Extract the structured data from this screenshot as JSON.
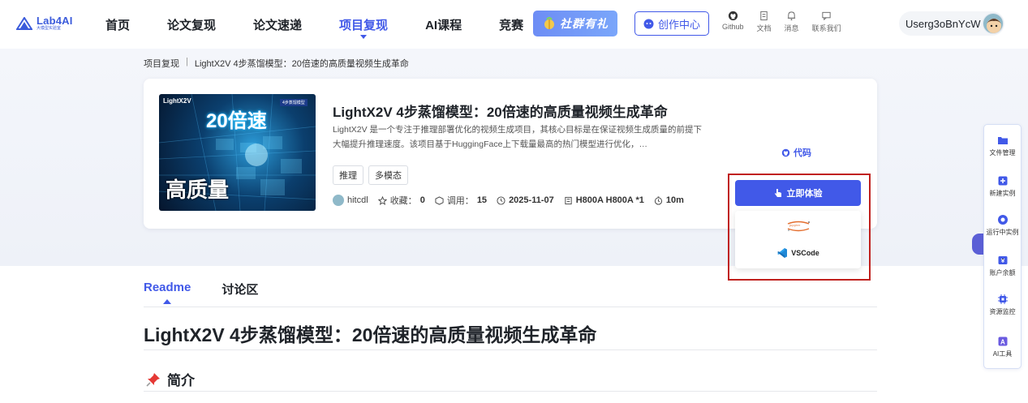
{
  "logo": {
    "name": "Lab4AI",
    "subtitle": "大模型实验室"
  },
  "nav": {
    "items": [
      {
        "label": "首页",
        "active": false
      },
      {
        "label": "论文复现",
        "active": false
      },
      {
        "label": "论文速递",
        "active": false
      },
      {
        "label": "项目复现",
        "active": true
      },
      {
        "label": "AI课程",
        "active": false
      },
      {
        "label": "竞赛",
        "active": false
      }
    ],
    "promo_label": "社群有礼",
    "create_label": "创作中心",
    "tools": [
      {
        "label": "Github",
        "icon": "github-icon"
      },
      {
        "label": "文档",
        "icon": "document-icon"
      },
      {
        "label": "消息",
        "icon": "bell-icon"
      },
      {
        "label": "联系我们",
        "icon": "chat-icon"
      }
    ],
    "username": "Userg3oBnYcW"
  },
  "breadcrumb": {
    "parent": "项目复现",
    "current": "LightX2V 4步蒸馏模型：20倍速的高质量视频生成革命"
  },
  "project": {
    "cover": {
      "brand": "LightX2V",
      "tag": "4步蒸馏模型",
      "speed": "20倍速",
      "quality": "高质量"
    },
    "title": "LightX2V 4步蒸馏模型：20倍速的高质量视频生成革命",
    "description": "LightX2V 是一个专注于推理部署优化的视频生成项目，其核心目标是在保证视频生成质量的前提下大幅提升推理速度。该项目基于HuggingFace上下载量最高的热门模型进行优化，…",
    "tags": [
      "推理",
      "多模态"
    ],
    "author": "hitcdl",
    "favorites_label": "收藏：",
    "favorites": "0",
    "calls_label": "调用：",
    "calls": "15",
    "date": "2025-11-07",
    "hardware": "H800A H800A *1",
    "duration": "10m",
    "code_label": "代码",
    "try_label": "立即体验",
    "dropdown": {
      "jupyter_label": "jupyter",
      "vscode_label": "VSCode"
    }
  },
  "readme": {
    "tabs": [
      {
        "label": "Readme",
        "active": true
      },
      {
        "label": "讨论区",
        "active": false
      }
    ],
    "title": "LightX2V 4步蒸馏模型：20倍速的高质量视频生成革命",
    "section_title": "简介"
  },
  "side_panel": {
    "items": [
      {
        "label": "文件管理",
        "icon": "folder-icon"
      },
      {
        "label": "新建实例",
        "icon": "add-instance-icon"
      },
      {
        "label": "运行中实例",
        "icon": "running-instance-icon"
      },
      {
        "label": "账户余额",
        "icon": "balance-icon"
      },
      {
        "label": "资源监控",
        "icon": "chip-icon"
      },
      {
        "label": "AI工具",
        "icon": "ai-tool-icon"
      }
    ]
  },
  "colors": {
    "accent": "#4159e8",
    "highlight_border": "#c0201d"
  }
}
